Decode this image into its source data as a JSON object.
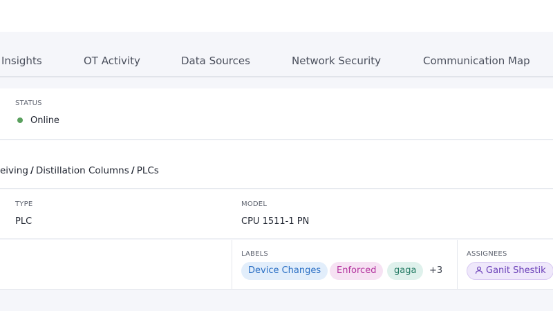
{
  "tabs": [
    {
      "label": "Insights"
    },
    {
      "label": "OT Activity"
    },
    {
      "label": "Data Sources"
    },
    {
      "label": "Network Security"
    },
    {
      "label": "Communication Map"
    }
  ],
  "status": {
    "label": "STATUS",
    "value": "Online",
    "color": "#5aa05e"
  },
  "path": {
    "segments": [
      "eiving",
      "Distillation Columns",
      "PLCs"
    ],
    "separator": "/"
  },
  "details": {
    "type_label": "TYPE",
    "type_value": "PLC",
    "model_label": "MODEL",
    "model_value": "CPU 1511-1 PN"
  },
  "labels": {
    "label": "LABELS",
    "chips": [
      "Device Changes",
      "Enforced",
      "gaga"
    ],
    "more": "+3"
  },
  "assignees": {
    "label": "ASSIGNEES",
    "items": [
      "Ganit Shestik"
    ],
    "icon": "user-icon"
  }
}
